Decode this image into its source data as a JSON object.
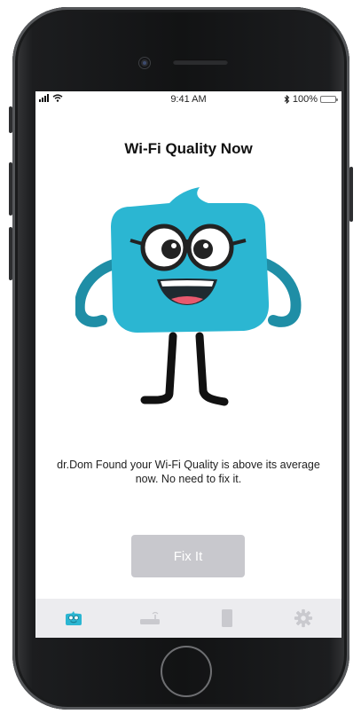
{
  "status_bar": {
    "time": "9:41 AM",
    "battery": "100%",
    "bluetooth_icon": "bluetooth-icon",
    "wifi_icon": "wifi-icon",
    "signal_icon": "signal-icon"
  },
  "screen": {
    "title": "Wi-Fi Quality Now",
    "message": "dr.Dom Found your Wi-Fi Quality is above its average now. No need to fix it.",
    "fix_button": "Fix It"
  },
  "tabbar": {
    "tabs": [
      {
        "icon": "robot-icon",
        "active": true
      },
      {
        "icon": "router-icon",
        "active": false
      },
      {
        "icon": "phone-icon",
        "active": false
      },
      {
        "icon": "gear-icon",
        "active": false
      }
    ]
  },
  "colors": {
    "mascot": "#2bb6d2",
    "tab_active": "#2bb6d2",
    "tab_inactive": "#c9c9ce",
    "button_disabled": "#c8c8cd",
    "battery": "#f5d21a"
  }
}
